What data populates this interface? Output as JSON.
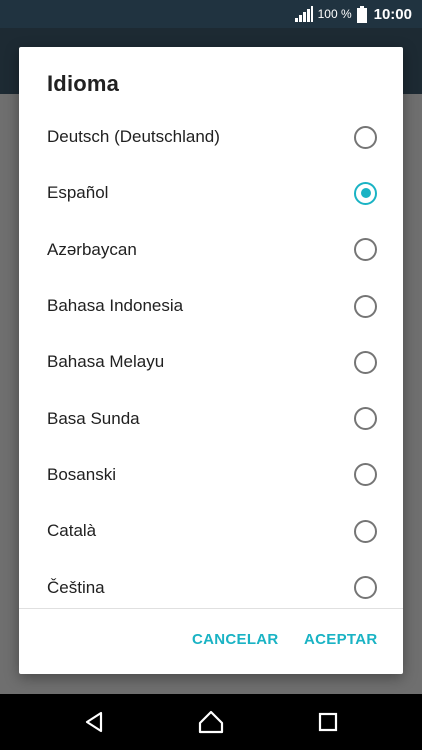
{
  "status_bar": {
    "battery_percent": "100 %",
    "time": "10:00",
    "icons": [
      "signal-icon",
      "battery-icon"
    ]
  },
  "dialog": {
    "title": "Idioma",
    "selected_index": 1,
    "options": [
      {
        "label": "Deutsch (Deutschland)",
        "checked": false
      },
      {
        "label": "Español",
        "checked": true
      },
      {
        "label": "Azərbaycan",
        "checked": false
      },
      {
        "label": "Bahasa Indonesia",
        "checked": false
      },
      {
        "label": "Bahasa Melayu",
        "checked": false
      },
      {
        "label": "Basa Sunda",
        "checked": false
      },
      {
        "label": "Bosanski",
        "checked": false
      },
      {
        "label": "Català",
        "checked": false
      },
      {
        "label": "Čeština",
        "checked": false
      }
    ],
    "cancel_label": "CANCELAR",
    "accept_label": "ACEPTAR"
  },
  "nav_bar": {
    "icons": [
      "back-icon",
      "home-icon",
      "recents-icon"
    ]
  },
  "colors": {
    "accent": "#1ab3c4",
    "status_bar": "#203340",
    "dialog_background": "#ffffff",
    "text_primary": "#212121"
  }
}
